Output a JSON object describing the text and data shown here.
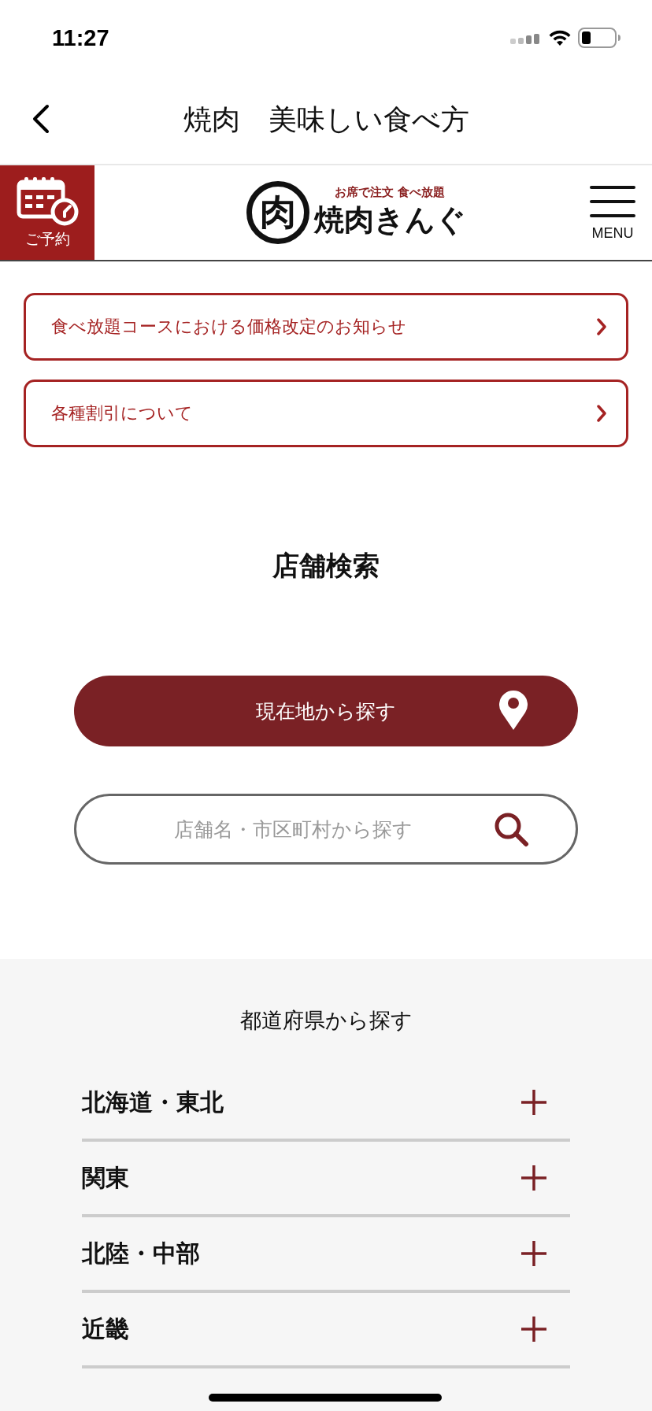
{
  "status_bar": {
    "time": "11:27"
  },
  "nav_bar": {
    "title": "焼肉　美味しい食べ方"
  },
  "header": {
    "reserve_label": "ご予約",
    "logo": {
      "mark": "肉",
      "tagline": "お席で注文 食べ放題",
      "name": "焼肉きんぐ"
    },
    "menu_label": "MENU"
  },
  "notices": [
    {
      "text": "食べ放題コースにおける価格改定のお知らせ"
    },
    {
      "text": "各種割引について"
    }
  ],
  "store_search": {
    "title": "店舗検索",
    "locate_button": "現在地から探す",
    "search": {
      "placeholder": "店舗名・市区町村から探す"
    }
  },
  "prefecture_search": {
    "title": "都道府県から探す",
    "regions": [
      {
        "name": "北海道・東北",
        "expanded": false
      },
      {
        "name": "関東",
        "expanded": false
      },
      {
        "name": "北陸・中部",
        "expanded": false
      },
      {
        "name": "近畿",
        "expanded": false
      }
    ]
  }
}
